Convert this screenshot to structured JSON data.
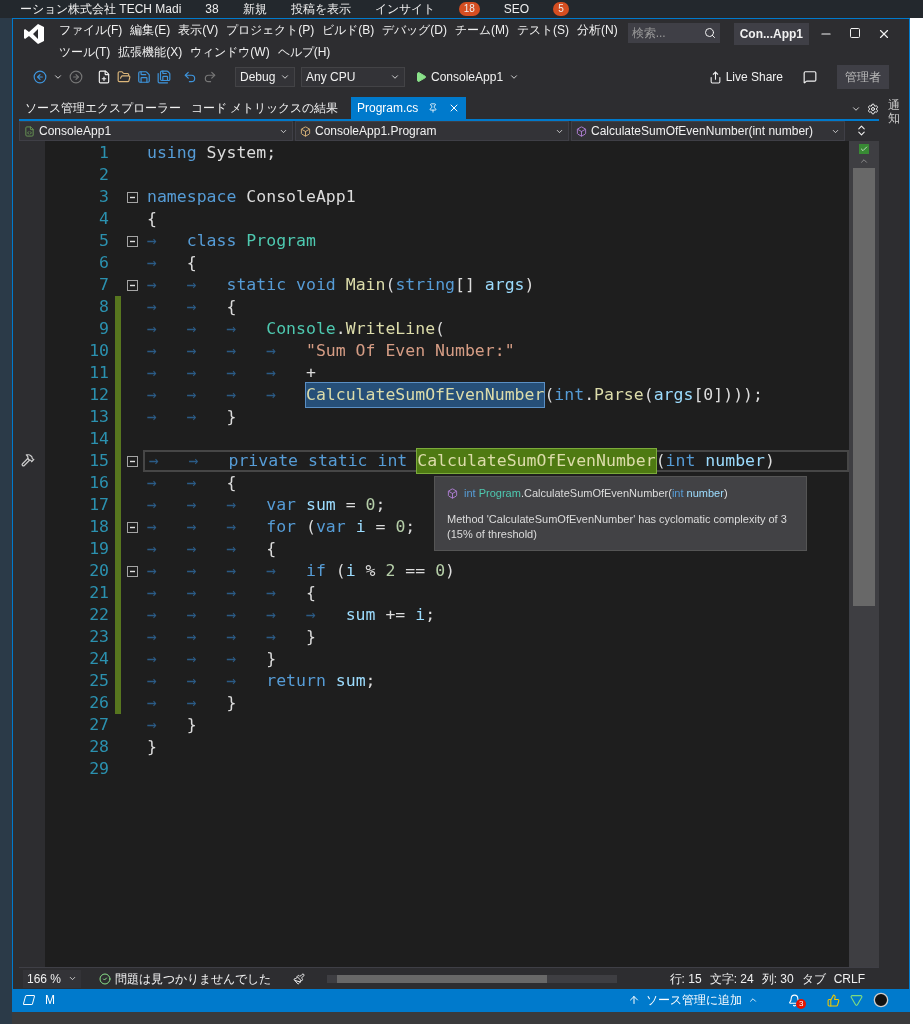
{
  "background_page": {
    "admin_bar": [
      {
        "text": "ーション株式会社 TECH Madi"
      },
      {
        "text": "38"
      },
      {
        "text": "新規"
      },
      {
        "text": "投稿を表示"
      },
      {
        "text": "インサイト"
      },
      {
        "text": "18",
        "kind": "badge"
      },
      {
        "text": "SEO"
      },
      {
        "text": "5",
        "kind": "badge"
      }
    ]
  },
  "window": {
    "title": "Con...App1",
    "search": {
      "placeholder": "検索..."
    }
  },
  "menu": {
    "rows": [
      {
        "items": [
          "ファイル(F)",
          "編集(E)",
          "表示(V)",
          "プロジェクト(P)",
          "ビルド(B)",
          "デバッグ(D)",
          "チーム(M)",
          "テスト(S)",
          "分析(N)"
        ]
      },
      {
        "items": [
          "ツール(T)",
          "拡張機能(X)",
          "ウィンドウ(W)",
          "ヘルプ(H)"
        ]
      }
    ]
  },
  "toolbar": {
    "configuration": "Debug",
    "platform": "Any CPU",
    "start": "ConsoleApp1",
    "live_share": "Live Share",
    "account": "管理者"
  },
  "doc_tabs": [
    {
      "label": "ソース管理エクスプローラー",
      "selected": false
    },
    {
      "label": "コード メトリックスの結果",
      "selected": false
    },
    {
      "label": "Program.cs",
      "selected": true
    }
  ],
  "nav_bar": {
    "project": "ConsoleApp1",
    "type": "ConsoleApp1.Program",
    "member": "CalculateSumOfEvenNumber(int number)"
  },
  "side_panel": {
    "label": "通知"
  },
  "editor": {
    "lines": [
      {
        "number": "1",
        "tokens": [
          {
            "kind": "keyword",
            "text": "using "
          },
          {
            "kind": "plain",
            "text": "System;"
          }
        ]
      },
      {
        "number": "2"
      },
      {
        "number": "3",
        "collapsible": true,
        "tokens": [
          {
            "kind": "keyword",
            "text": "namespace "
          },
          {
            "kind": "plain",
            "text": "ConsoleApp1"
          }
        ]
      },
      {
        "number": "4",
        "tokens": [
          {
            "kind": "plain",
            "text": "{"
          }
        ]
      },
      {
        "number": "5",
        "collapsible": true,
        "tokens": [
          {
            "kind": "indent",
            "text": "→"
          },
          {
            "kind": "keyword",
            "text": "class "
          },
          {
            "kind": "type",
            "text": "Program"
          }
        ]
      },
      {
        "number": "6",
        "tokens": [
          {
            "kind": "indent",
            "text": "→"
          },
          {
            "kind": "plain",
            "text": "{"
          }
        ]
      },
      {
        "number": "7",
        "collapsible": true,
        "tokens": [
          {
            "kind": "indent",
            "text": "→→"
          },
          {
            "kind": "keyword",
            "text": "static void "
          },
          {
            "kind": "method",
            "text": "Main"
          },
          {
            "kind": "plain",
            "text": "("
          },
          {
            "kind": "keyword",
            "text": "string"
          },
          {
            "kind": "plain",
            "text": "[] "
          },
          {
            "kind": "variable",
            "text": "args"
          },
          {
            "kind": "plain",
            "text": ")"
          }
        ]
      },
      {
        "number": "8",
        "changed": true,
        "tokens": [
          {
            "kind": "indent",
            "text": "→→"
          },
          {
            "kind": "plain",
            "text": "{"
          }
        ]
      },
      {
        "number": "9",
        "changed": true,
        "tokens": [
          {
            "kind": "indent",
            "text": "→→→"
          },
          {
            "kind": "type",
            "text": "Console"
          },
          {
            "kind": "plain",
            "text": "."
          },
          {
            "kind": "method",
            "text": "WriteLine"
          },
          {
            "kind": "plain",
            "text": "("
          }
        ]
      },
      {
        "number": "10",
        "changed": true,
        "tokens": [
          {
            "kind": "indent",
            "text": "→→→→"
          },
          {
            "kind": "string",
            "text": "\"Sum Of Even Number:\""
          }
        ]
      },
      {
        "number": "11",
        "changed": true,
        "tokens": [
          {
            "kind": "indent",
            "text": "→→→→"
          },
          {
            "kind": "plain",
            "text": "+"
          }
        ]
      },
      {
        "number": "12",
        "changed": true,
        "tokens": [
          {
            "kind": "indent",
            "text": "→→→→"
          },
          {
            "kind": "method",
            "text": "CalculateSumOfEvenNumber",
            "reference_highlight": true
          },
          {
            "kind": "plain",
            "text": "("
          },
          {
            "kind": "keyword",
            "text": "int"
          },
          {
            "kind": "plain",
            "text": "."
          },
          {
            "kind": "method",
            "text": "Parse"
          },
          {
            "kind": "plain",
            "text": "("
          },
          {
            "kind": "variable",
            "text": "args"
          },
          {
            "kind": "plain",
            "text": "[0])));"
          }
        ]
      },
      {
        "number": "13",
        "changed": true,
        "tokens": [
          {
            "kind": "indent",
            "text": "→→"
          },
          {
            "kind": "plain",
            "text": "}"
          }
        ]
      },
      {
        "number": "14",
        "changed": true
      },
      {
        "number": "15",
        "changed": true,
        "collapsible": true,
        "current": true,
        "tokens": [
          {
            "kind": "indent",
            "text": "→→"
          },
          {
            "kind": "keyword",
            "text": "private static int "
          },
          {
            "kind": "method",
            "text": "CalculateSumOfEvenNumber",
            "definition_highlight": true
          },
          {
            "kind": "plain",
            "text": "("
          },
          {
            "kind": "keyword",
            "text": "int "
          },
          {
            "kind": "variable",
            "text": "number"
          },
          {
            "kind": "plain",
            "text": ")"
          }
        ]
      },
      {
        "number": "16",
        "changed": true,
        "tokens": [
          {
            "kind": "indent",
            "text": "→→"
          },
          {
            "kind": "plain",
            "text": "{"
          }
        ]
      },
      {
        "number": "17",
        "changed": true,
        "tokens": [
          {
            "kind": "indent",
            "text": "→→→"
          },
          {
            "kind": "keyword",
            "text": "var "
          },
          {
            "kind": "variable",
            "text": "sum"
          },
          {
            "kind": "plain",
            "text": " = "
          },
          {
            "kind": "number",
            "text": "0"
          },
          {
            "kind": "plain",
            "text": ";"
          }
        ]
      },
      {
        "number": "18",
        "changed": true,
        "collapsible": true,
        "tokens": [
          {
            "kind": "indent",
            "text": "→→→"
          },
          {
            "kind": "keyword",
            "text": "for"
          },
          {
            "kind": "plain",
            "text": " ("
          },
          {
            "kind": "keyword",
            "text": "var "
          },
          {
            "kind": "variable",
            "text": "i"
          },
          {
            "kind": "plain",
            "text": " = "
          },
          {
            "kind": "number",
            "text": "0"
          },
          {
            "kind": "plain",
            "text": ";"
          }
        ]
      },
      {
        "number": "19",
        "changed": true,
        "tokens": [
          {
            "kind": "indent",
            "text": "→→→"
          },
          {
            "kind": "plain",
            "text": "{"
          }
        ]
      },
      {
        "number": "20",
        "changed": true,
        "collapsible": true,
        "tokens": [
          {
            "kind": "indent",
            "text": "→→→→"
          },
          {
            "kind": "keyword",
            "text": "if"
          },
          {
            "kind": "plain",
            "text": " ("
          },
          {
            "kind": "variable",
            "text": "i"
          },
          {
            "kind": "plain",
            "text": " % "
          },
          {
            "kind": "number",
            "text": "2"
          },
          {
            "kind": "plain",
            "text": " == "
          },
          {
            "kind": "number",
            "text": "0"
          },
          {
            "kind": "plain",
            "text": ")"
          }
        ]
      },
      {
        "number": "21",
        "changed": true,
        "tokens": [
          {
            "kind": "indent",
            "text": "→→→→"
          },
          {
            "kind": "plain",
            "text": "{"
          }
        ]
      },
      {
        "number": "22",
        "changed": true,
        "tokens": [
          {
            "kind": "indent",
            "text": "→→→→→"
          },
          {
            "kind": "variable",
            "text": "sum"
          },
          {
            "kind": "plain",
            "text": " += "
          },
          {
            "kind": "variable",
            "text": "i"
          },
          {
            "kind": "plain",
            "text": ";"
          }
        ]
      },
      {
        "number": "23",
        "changed": true,
        "tokens": [
          {
            "kind": "indent",
            "text": "→→→→"
          },
          {
            "kind": "plain",
            "text": "}"
          }
        ]
      },
      {
        "number": "24",
        "changed": true,
        "tokens": [
          {
            "kind": "indent",
            "text": "→→→"
          },
          {
            "kind": "plain",
            "text": "}"
          }
        ]
      },
      {
        "number": "25",
        "changed": true,
        "tokens": [
          {
            "kind": "indent",
            "text": "→→→"
          },
          {
            "kind": "keyword",
            "text": "return "
          },
          {
            "kind": "variable",
            "text": "sum"
          },
          {
            "kind": "plain",
            "text": ";"
          }
        ]
      },
      {
        "number": "26",
        "changed": true,
        "tokens": [
          {
            "kind": "indent",
            "text": "→→"
          },
          {
            "kind": "plain",
            "text": "}"
          }
        ]
      },
      {
        "number": "27",
        "tokens": [
          {
            "kind": "indent",
            "text": "→"
          },
          {
            "kind": "plain",
            "text": "}"
          }
        ]
      },
      {
        "number": "28",
        "tokens": [
          {
            "kind": "plain",
            "text": "}"
          }
        ]
      },
      {
        "number": "29"
      }
    ],
    "tooltip": {
      "signature": [
        {
          "kind": "keyword",
          "text": "int "
        },
        {
          "kind": "type",
          "text": "Program"
        },
        {
          "kind": "plain",
          "text": ".CalculateSumOfEvenNumber("
        },
        {
          "kind": "keyword",
          "text": "int "
        },
        {
          "kind": "variable",
          "text": "number"
        },
        {
          "kind": "plain",
          "text": ")"
        }
      ],
      "description": "Method 'CalculateSumOfEvenNumber' has cyclomatic complexity of 3 (15% of threshold)"
    }
  },
  "status_row": {
    "zoom": "166 %",
    "issues": "問題は見つかりませんでした",
    "line": "行: 15",
    "char": "文字: 24",
    "column": "列: 30",
    "tabs": "タブ",
    "line_ending": "CRLF"
  },
  "status_bar": {
    "branch": "M",
    "source_control": "ソース管理に追加",
    "notifications": "3"
  }
}
